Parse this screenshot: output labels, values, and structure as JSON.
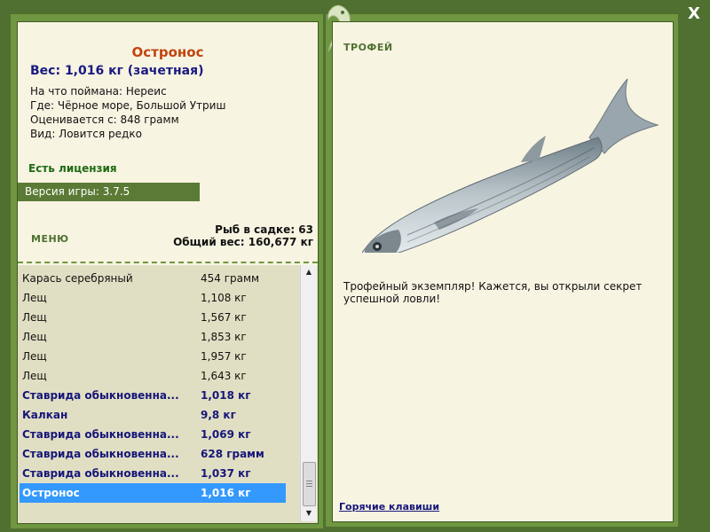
{
  "fish": {
    "name": "Остронос",
    "weight_line": "Вес: 1,016 кг (зачетная)",
    "caught_on": "На что поймана: Нереис",
    "location": "Где: Чёрное море, Большой Утриш",
    "rated_from": "Оценивается с: 848 грамм",
    "kind": "Вид: Ловится редко"
  },
  "license_text": "Есть лицензия",
  "version_text": "Версия игры: 3.7.5",
  "menu_label": "МЕНЮ",
  "stats": {
    "fish_in_keepnet": "Рыб в садке: 63",
    "total_weight": "Общий вес: 160,677 кг"
  },
  "catch_list": [
    {
      "name": "Карась серебряный",
      "weight": "454 грамм",
      "trophy": false,
      "selected": false
    },
    {
      "name": "Лещ",
      "weight": "1,108 кг",
      "trophy": false,
      "selected": false
    },
    {
      "name": "Лещ",
      "weight": "1,567 кг",
      "trophy": false,
      "selected": false
    },
    {
      "name": "Лещ",
      "weight": "1,853 кг",
      "trophy": false,
      "selected": false
    },
    {
      "name": "Лещ",
      "weight": "1,957 кг",
      "trophy": false,
      "selected": false
    },
    {
      "name": "Лещ",
      "weight": "1,643 кг",
      "trophy": false,
      "selected": false
    },
    {
      "name": "Ставрида обыкновенна...",
      "weight": "1,018 кг",
      "trophy": true,
      "selected": false
    },
    {
      "name": "Калкан",
      "weight": "9,8 кг",
      "trophy": true,
      "selected": false
    },
    {
      "name": "Ставрида обыкновенна...",
      "weight": "1,069 кг",
      "trophy": true,
      "selected": false
    },
    {
      "name": "Ставрида обыкновенна...",
      "weight": "628 грамм",
      "trophy": true,
      "selected": false
    },
    {
      "name": "Ставрида обыкновенна...",
      "weight": "1,037 кг",
      "trophy": true,
      "selected": false
    },
    {
      "name": "Остронос",
      "weight": "1,016 кг",
      "trophy": true,
      "selected": true
    }
  ],
  "trophy_label": "ТРОФЕЙ",
  "description": "Трофейный экземпляр! Кажется, вы открыли секрет успешной ловли!",
  "hotkeys_label": "Горячие клавиши",
  "close_label": "X",
  "icons": {
    "close": "close-icon",
    "logo": "fish-logo-icon",
    "scroll_up": "chevron-up-icon",
    "scroll_down": "chevron-down-icon"
  },
  "colors": {
    "frame": "#4f7030",
    "panel": "#f7f4e2",
    "title": "#c1440e",
    "trophy_text": "#16167a",
    "selection": "#3399ff"
  }
}
